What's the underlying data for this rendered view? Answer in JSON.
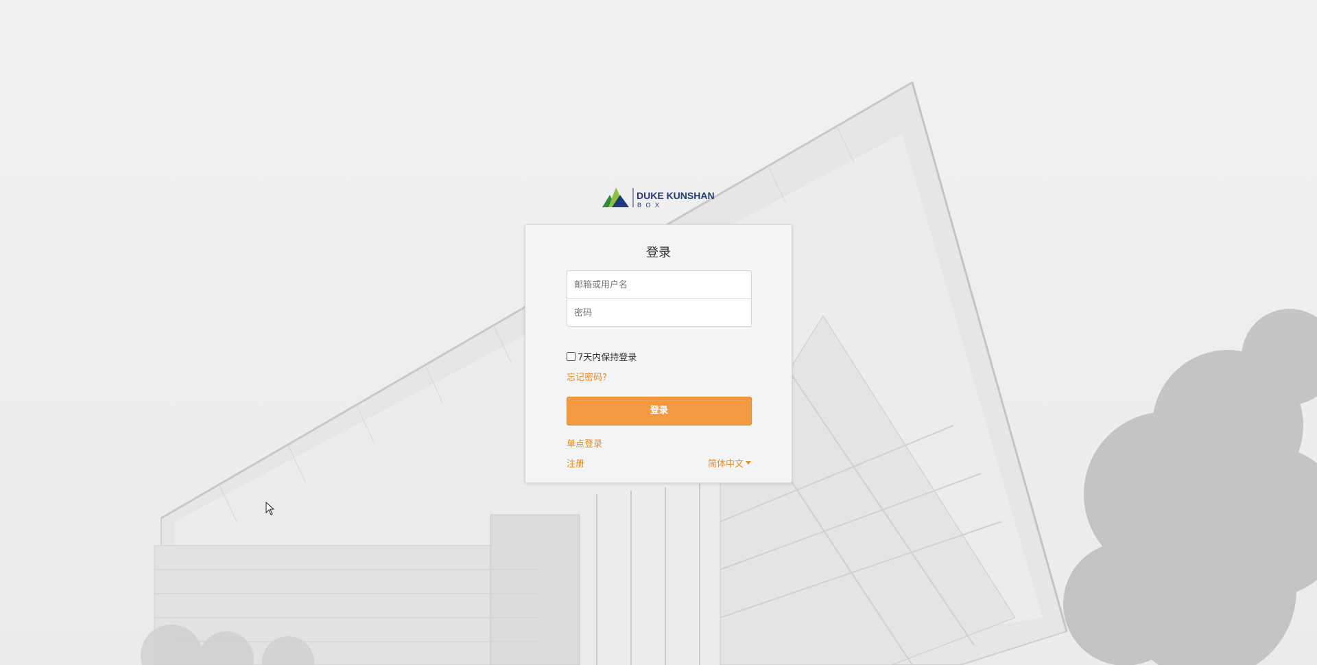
{
  "logo": {
    "brand_name": "DUKE KUNSHAN",
    "brand_sub": "B O X",
    "colors": {
      "navy": "#1f3a7a",
      "green": "#2e8b3a",
      "lime": "#8fc03f"
    }
  },
  "login_form": {
    "title": "登录",
    "username_placeholder": "邮箱或用户名",
    "password_placeholder": "密码",
    "remember_label": "7天内保持登录",
    "remember_checked": false,
    "forgot_password": "忘记密码?",
    "submit_label": "登录",
    "sso_label": "单点登录",
    "register_label": "注册",
    "language_label": "简体中文"
  },
  "colors": {
    "accent": "#e8891f",
    "button": "#f19a42",
    "card_bg": "#f3f4f5"
  }
}
